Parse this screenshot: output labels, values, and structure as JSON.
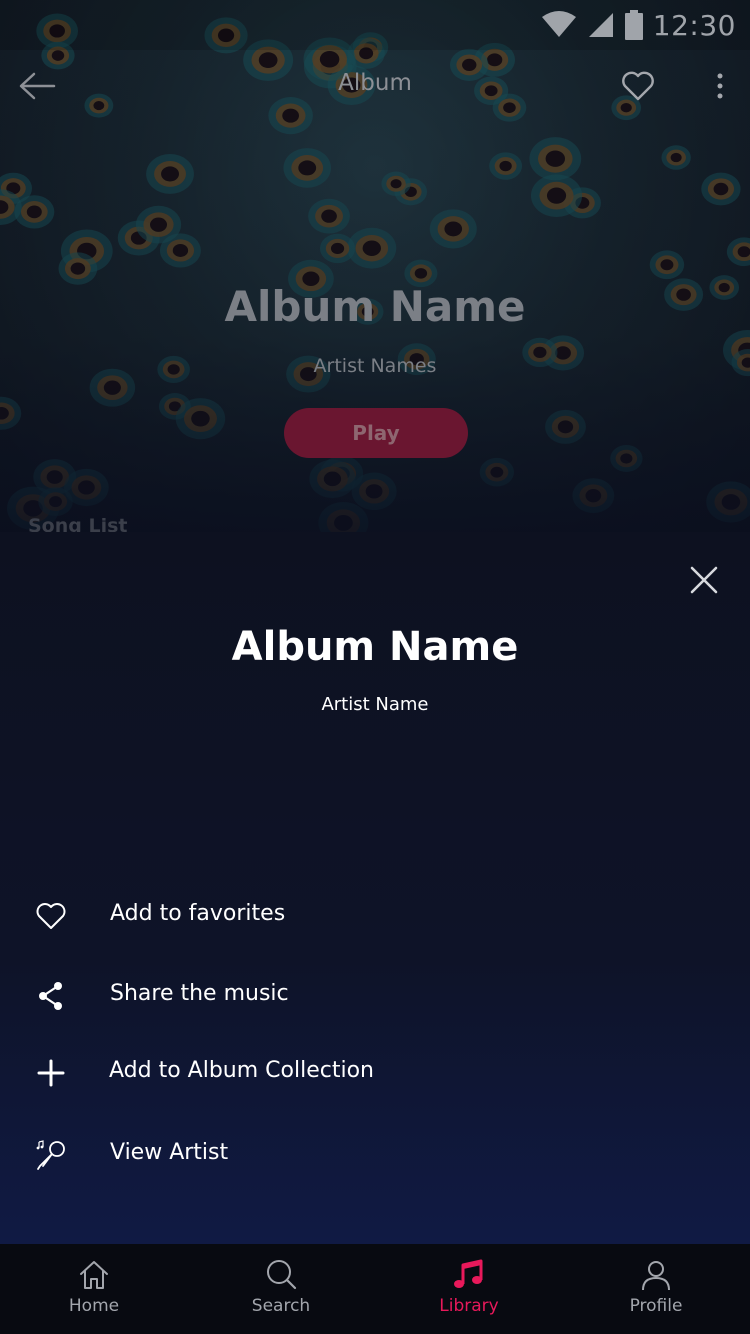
{
  "status_bar": {
    "time": "12:30"
  },
  "app_bar": {
    "title": "Album"
  },
  "hero": {
    "album_name": "Album Name",
    "artist_names": "Artist Names",
    "play_label": "Play",
    "song_list_label": "Song List"
  },
  "sheet": {
    "album_name": "Album Name",
    "artist_name": "Artist Name",
    "actions": [
      {
        "label": "Add to favorites",
        "icon": "heart-outline-icon"
      },
      {
        "label": "Share the music",
        "icon": "share-icon"
      },
      {
        "label": "Add to Album Collection",
        "icon": "plus-icon"
      },
      {
        "label": "View Artist",
        "icon": "microphone-icon"
      }
    ]
  },
  "bottom_nav": {
    "items": [
      {
        "label": "Home",
        "icon": "home-icon"
      },
      {
        "label": "Search",
        "icon": "search-icon"
      },
      {
        "label": "Library",
        "icon": "music-note-icon",
        "active": true
      },
      {
        "label": "Profile",
        "icon": "profile-icon"
      }
    ]
  },
  "colors": {
    "accent": "#e8195b",
    "sheet_background": "#0d1120",
    "nav_background": "#080a11"
  }
}
